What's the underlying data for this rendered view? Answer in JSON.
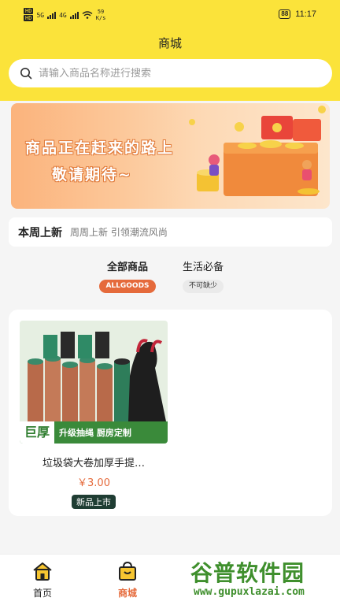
{
  "status_bar": {
    "hd_top": "HD",
    "hd_bottom": "HD",
    "net1": "5G",
    "net2": "4G",
    "speed_value": "59",
    "speed_unit": "K/s",
    "battery": "88",
    "time": "11:17"
  },
  "header": {
    "title": "商城"
  },
  "search": {
    "placeholder": "请输入商品名称进行搜索"
  },
  "banner": {
    "line1": "商品正在赶来的路上",
    "line2": "敬请期待~"
  },
  "weekly": {
    "title": "本周上新",
    "subtitle": "周周上新 引领潮流风尚"
  },
  "category_tabs": [
    {
      "label": "全部商品",
      "pill": "ALLGOODS",
      "active": true
    },
    {
      "label": "生活必备",
      "pill": "不可缺少",
      "active": false
    }
  ],
  "products": [
    {
      "image_banner_big": "巨厚",
      "image_banner_small": "升级抽绳 厨房定制",
      "name": "垃圾袋大卷加厚手提…",
      "price": "￥3.00",
      "badge": "新品上市"
    }
  ],
  "bottom_nav": [
    {
      "label": "首页",
      "icon": "home-icon",
      "active": false
    },
    {
      "label": "商城",
      "icon": "shop-bag-icon",
      "active": true
    }
  ],
  "watermark": {
    "text": "谷普软件园",
    "url": "www.gupuxlazai.com"
  },
  "colors": {
    "header_yellow": "#fbe33a",
    "accent_orange": "#e56a3b",
    "badge_dark": "#1f3d33"
  }
}
